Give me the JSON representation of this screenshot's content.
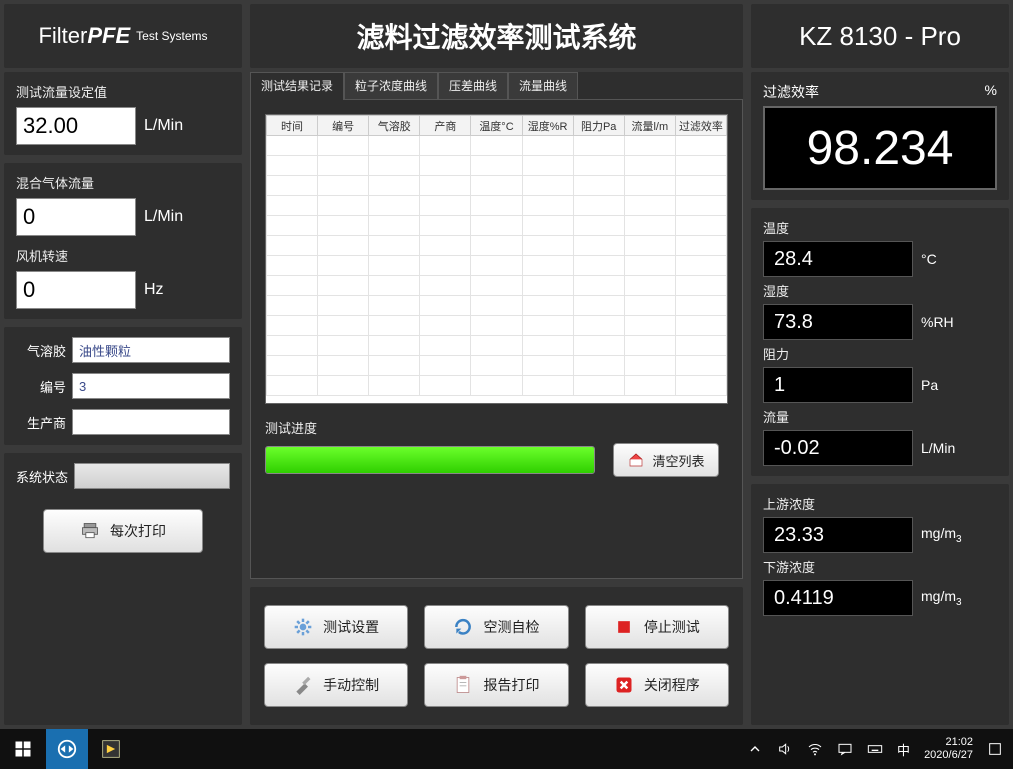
{
  "header": {
    "brand1": "Filter",
    "brand2": "PFE",
    "brand3": "Test Systems",
    "title": "滤料过滤效率测试系统",
    "model": "KZ 8130 - Pro"
  },
  "left": {
    "flow_set_label": "测试流量设定值",
    "flow_set_value": "32.00",
    "flow_set_unit": "L/Min",
    "mix_flow_label": "混合气体流量",
    "mix_flow_value": "0",
    "mix_flow_unit": "L/Min",
    "fan_speed_label": "风机转速",
    "fan_speed_value": "0",
    "fan_speed_unit": "Hz",
    "aerosol_label": "气溶胶",
    "aerosol_value": "油性颗粒",
    "serial_label": "编号",
    "serial_value": "3",
    "vendor_label": "生产商",
    "vendor_value": "",
    "status_label": "系统状态",
    "print_each_label": "每次打印"
  },
  "tabs": [
    "测试结果记录",
    "粒子浓度曲线",
    "压差曲线",
    "流量曲线"
  ],
  "table_headers": [
    "时间",
    "编号",
    "气溶胶",
    "产商",
    "温度°C",
    "湿度%R",
    "阻力Pa",
    "流量l/m",
    "过滤效率"
  ],
  "progress_label": "测试进度",
  "clear_list_label": "清空列表",
  "actions": {
    "settings": "测试设置",
    "selfcheck": "空测自检",
    "stop": "停止测试",
    "manual": "手动控制",
    "report": "报告打印",
    "close": "关闭程序"
  },
  "right": {
    "eff_label": "过滤效率",
    "eff_unit": "%",
    "eff_value": "98.234",
    "temp_label": "温度",
    "temp_value": "28.4",
    "temp_unit": "°C",
    "humid_label": "湿度",
    "humid_value": "73.8",
    "humid_unit": "%RH",
    "resist_label": "阻力",
    "resist_value": "1",
    "resist_unit": "Pa",
    "flow_label": "流量",
    "flow_value": "-0.02",
    "flow_unit": "L/Min",
    "up_label": "上游浓度",
    "up_value": "23.33",
    "up_unit_html": "mg/m",
    "down_label": "下游浓度",
    "down_value": "0.4119",
    "down_unit_html": "mg/m"
  },
  "taskbar": {
    "ime": "中",
    "time": "21:02",
    "date": "2020/6/27"
  }
}
